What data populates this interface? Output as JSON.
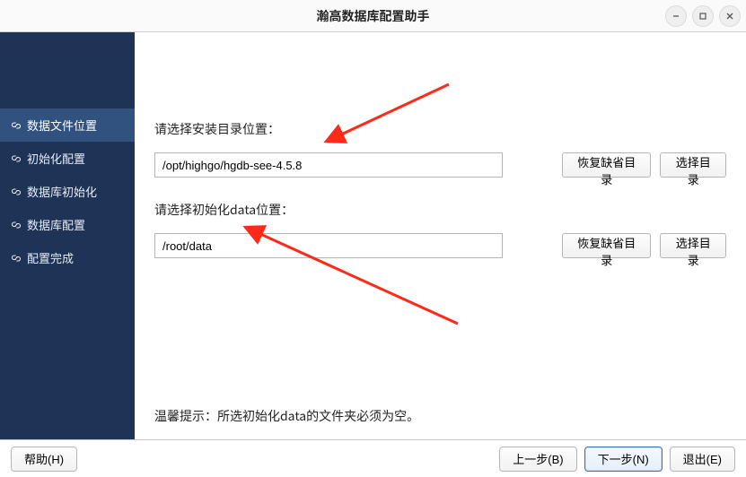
{
  "window": {
    "title": "瀚高数据库配置助手"
  },
  "sidebar": {
    "items": [
      {
        "label": "数据文件位置",
        "name": "sidebar-item-data-location"
      },
      {
        "label": "初始化配置",
        "name": "sidebar-item-init-config"
      },
      {
        "label": "数据库初始化",
        "name": "sidebar-item-db-init"
      },
      {
        "label": "数据库配置",
        "name": "sidebar-item-db-config"
      },
      {
        "label": "配置完成",
        "name": "sidebar-item-done"
      }
    ],
    "activeIndex": 0
  },
  "form": {
    "install": {
      "label": "请选择安装目录位置：",
      "value": "/opt/highgo/hgdb-see-4.5.8",
      "restoreLabel": "恢复缺省目录",
      "chooseLabel": "选择目录"
    },
    "data": {
      "label": "请选择初始化data位置：",
      "value": "/root/data",
      "restoreLabel": "恢复缺省目录",
      "chooseLabel": "选择目录"
    }
  },
  "hint": "温馨提示：所选初始化data的文件夹必须为空。",
  "footer": {
    "help": "帮助(H)",
    "prev": "上一步(B)",
    "next": "下一步(N)",
    "exit": "退出(E)"
  },
  "colors": {
    "sidebarBg": "#1e3356",
    "sidebarActive": "#31517e",
    "arrow": "#ff2a1a"
  }
}
